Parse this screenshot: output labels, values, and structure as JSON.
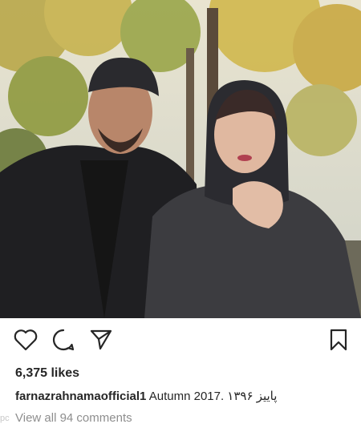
{
  "post": {
    "photo_alt": "photo",
    "likes_text": "6,375 likes",
    "caption": {
      "username": "farnazrahnamaofficial1",
      "text": "Autumn 2017. ۱۳۹۶ پاییز"
    },
    "view_comments": "View all 94 comments"
  },
  "icons": {
    "like": "heart-icon",
    "comment": "comment-bubble-icon",
    "share": "paper-plane-icon",
    "save": "bookmark-icon"
  },
  "watermark": "pc"
}
